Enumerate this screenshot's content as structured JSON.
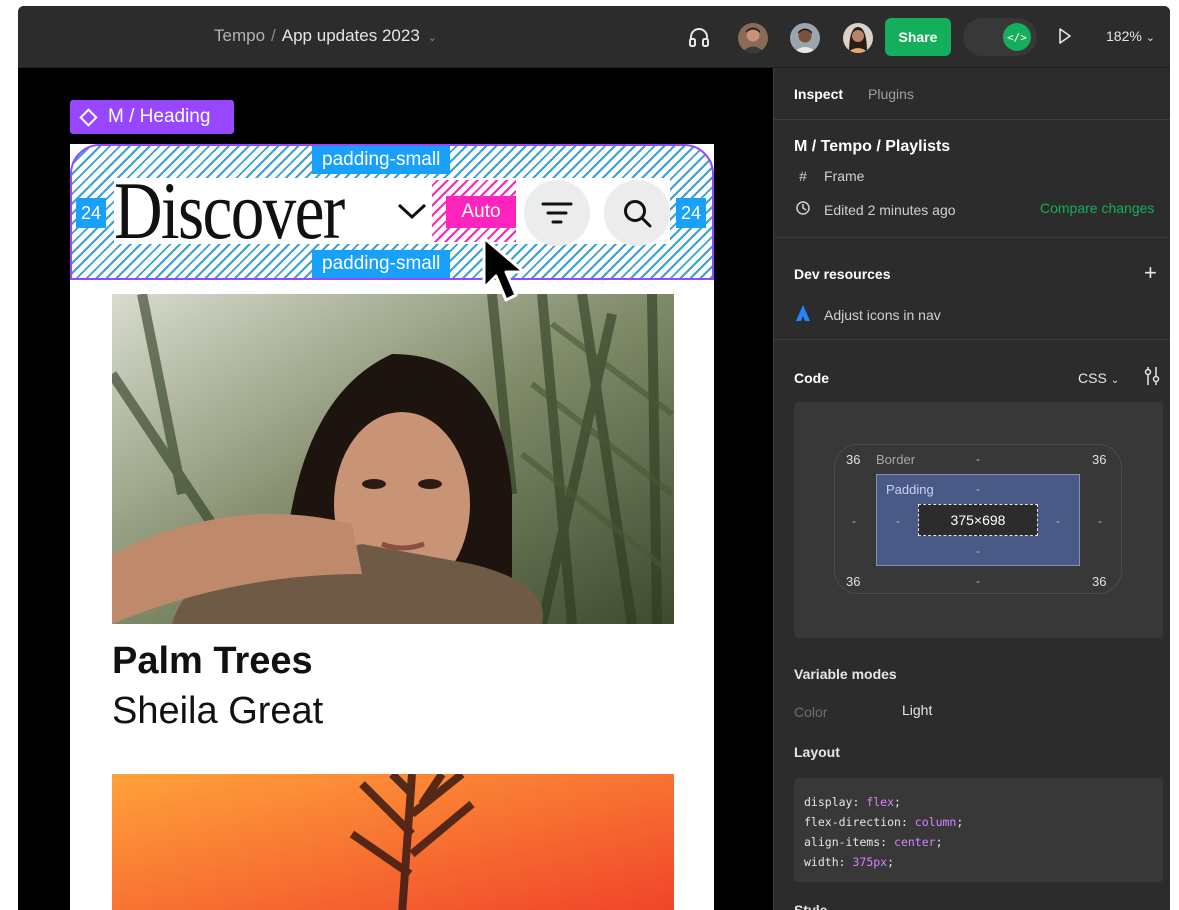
{
  "topbar": {
    "team": "Tempo",
    "separator": "/",
    "file": "App updates 2023",
    "share_label": "Share",
    "devmode_glyph": "</>",
    "zoom": "182%"
  },
  "canvas": {
    "component_tag": "M / Heading",
    "padding_top": "padding-small",
    "padding_bottom": "padding-small",
    "padding_left": "24",
    "padding_right": "24",
    "heading": "Discover",
    "auto_label": "Auto",
    "card": {
      "title": "Palm Trees",
      "subtitle": "Sheila Great"
    }
  },
  "panel": {
    "tabs": {
      "inspect": "Inspect",
      "plugins": "Plugins"
    },
    "title": "M / Tempo / Playlists",
    "type_label": "Frame",
    "edited": "Edited 2 minutes ago",
    "compare": "Compare changes",
    "dev_resources": {
      "heading": "Dev resources",
      "add": "+",
      "item": "Adjust icons in nav"
    },
    "code": {
      "heading": "Code",
      "language": "CSS",
      "boxmodel": {
        "border_label": "Border",
        "padding_label": "Padding",
        "radius_tl": "36",
        "radius_tr": "36",
        "radius_bl": "36",
        "radius_br": "36",
        "border_top": "-",
        "border_bottom": "-",
        "border_left": "-",
        "border_right": "-",
        "padding_top": "-",
        "padding_bottom": "-",
        "padding_left": "-",
        "padding_right": "-",
        "size": "375×698"
      }
    },
    "variable_modes": {
      "heading": "Variable modes",
      "key": "Color",
      "value": "Light"
    },
    "layout": {
      "heading": "Layout",
      "lines": [
        {
          "prop": "display",
          "value": "flex"
        },
        {
          "prop": "flex-direction",
          "value": "column"
        },
        {
          "prop": "align-items",
          "value": "center"
        },
        {
          "prop": "width",
          "value": "375px"
        }
      ]
    },
    "style_heading": "Style"
  },
  "colors": {
    "accent_green": "#14ae5c",
    "component_purple": "#9747ff",
    "spacing_blue": "#18a0fb",
    "auto_pink": "#ff24bd"
  }
}
